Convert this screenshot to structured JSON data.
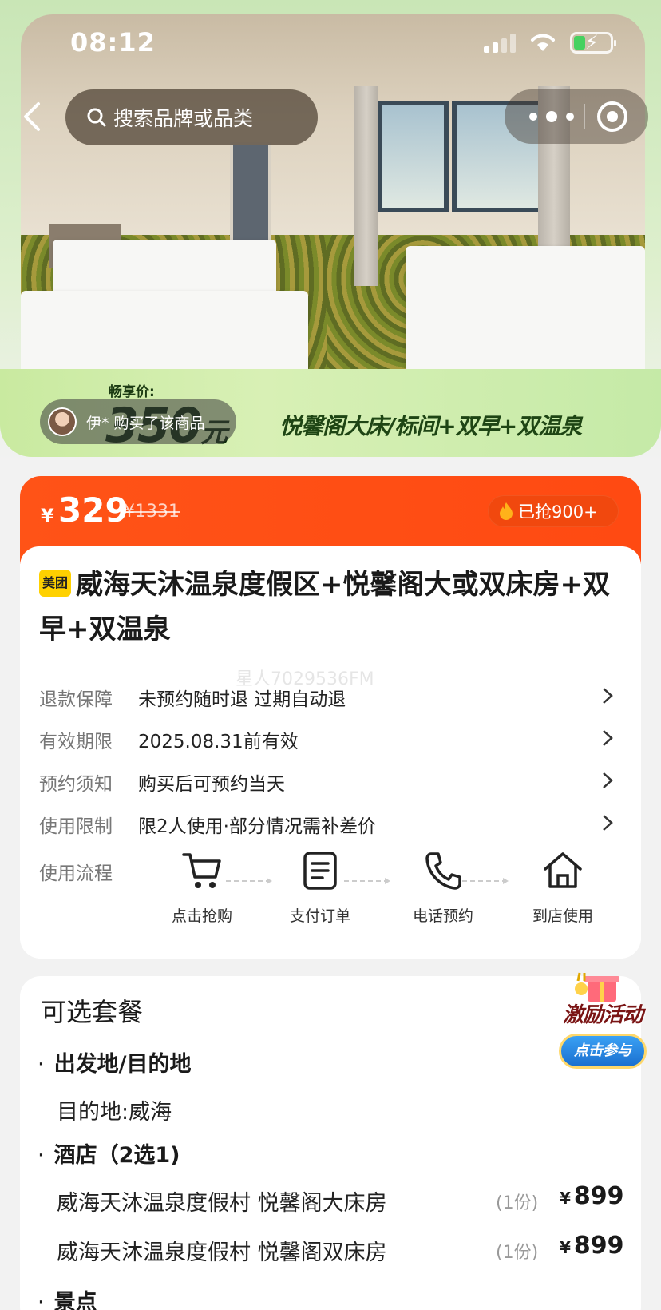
{
  "status_bar": {
    "time": "08:12"
  },
  "nav": {
    "search_placeholder": "搜索品牌或品类"
  },
  "promo": {
    "price_label": "畅享价:",
    "price_big": "350",
    "price_unit": "元",
    "banner_text": "悦馨阁大床/标间+双早+双温泉"
  },
  "buyer_notice": {
    "text": "伊* 购买了该商品"
  },
  "price": {
    "currency": "¥",
    "current": "329",
    "original": "¥1331",
    "sold": "已抢900+"
  },
  "product": {
    "brand_badge": "美团",
    "title": "威海天沐温泉度假区+悦馨阁大或双床房+双早+双温泉",
    "watermark": "星人7029536FM"
  },
  "details": [
    {
      "key": "退款保障",
      "value": "未预约随时退 过期自动退"
    },
    {
      "key": "有效期限",
      "value": "2025.08.31前有效"
    },
    {
      "key": "预约须知",
      "value": "购买后可预约当天"
    },
    {
      "key": "使用限制",
      "value": "限2人使用·部分情况需补差价"
    }
  ],
  "flow": {
    "label": "使用流程",
    "steps": [
      {
        "label": "点击抢购",
        "icon": "cart-icon"
      },
      {
        "label": "支付订单",
        "icon": "order-icon"
      },
      {
        "label": "电话预约",
        "icon": "phone-icon"
      },
      {
        "label": "到店使用",
        "icon": "home-icon"
      }
    ]
  },
  "packages": {
    "heading": "可选套餐",
    "sections": [
      {
        "title": "出发地/目的地",
        "items": [
          {
            "name": "目的地:威海"
          }
        ]
      },
      {
        "title": "酒店（2选1)",
        "items": [
          {
            "name": "威海天沐温泉度假村 悦馨阁大床房",
            "qty": "(1份)",
            "currency": "¥",
            "price": "899"
          },
          {
            "name": "威海天沐温泉度假村 悦馨阁双床房",
            "qty": "(1份)",
            "currency": "¥",
            "price": "899"
          }
        ]
      },
      {
        "title": "景点",
        "items": []
      }
    ]
  },
  "activity": {
    "title": "激励活动",
    "button": "点击参与"
  },
  "colors": {
    "accent": "#ff4f15",
    "promo_green": "#c9eaa0",
    "brand_yellow": "#ffd100"
  }
}
